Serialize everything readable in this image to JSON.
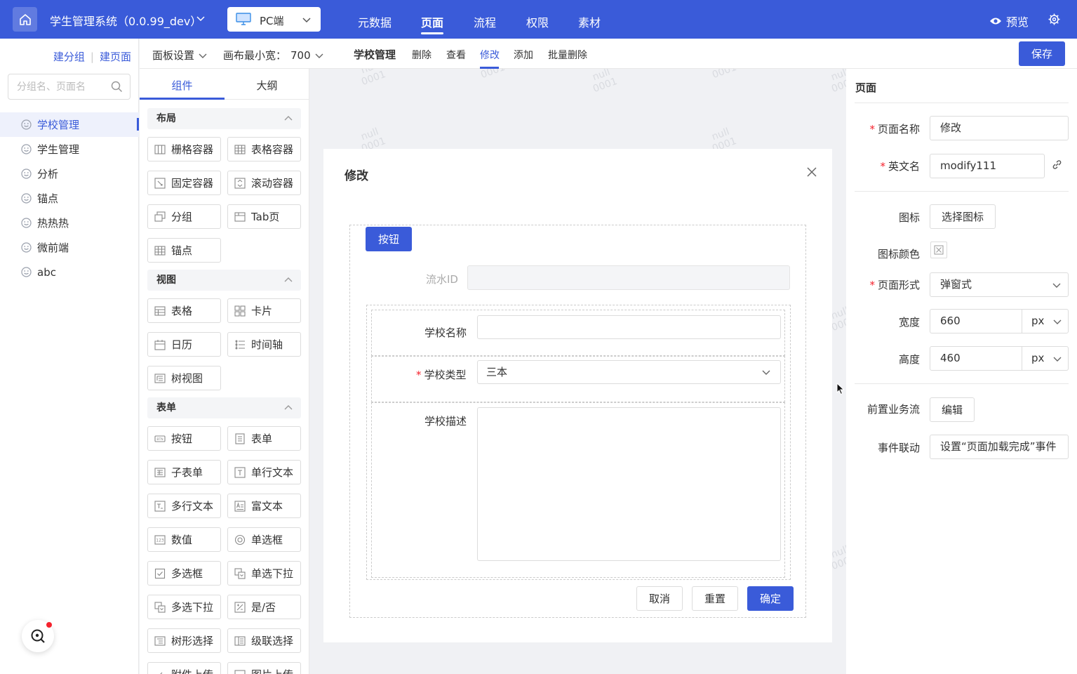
{
  "topbar": {
    "app_title": "学生管理系统（0.0.99_dev）",
    "platform": "PC端",
    "nav": [
      "元数据",
      "页面",
      "流程",
      "权限",
      "素材"
    ],
    "nav_active": "页面",
    "preview": "预览"
  },
  "sidebar": {
    "add_group": "建分组",
    "add_page": "建页面",
    "search_placeholder": "分组名、页面名",
    "items": [
      {
        "label": "学校管理",
        "active": true
      },
      {
        "label": "学生管理",
        "active": false
      },
      {
        "label": "分析",
        "active": false
      },
      {
        "label": "锚点",
        "active": false
      },
      {
        "label": "热热热",
        "active": false
      },
      {
        "label": "微前端",
        "active": false
      },
      {
        "label": "abc",
        "active": false
      }
    ]
  },
  "toolbar": {
    "panel_settings": "面板设置",
    "canvas_min_width_label": "画布最小宽：",
    "canvas_min_width_value": "700",
    "page_tabs": [
      "学校管理",
      "删除",
      "查看",
      "修改",
      "添加",
      "批量删除"
    ],
    "active_tab": "修改",
    "save": "保存"
  },
  "components": {
    "tabs": [
      "组件",
      "大纲"
    ],
    "active_tab": "组件",
    "groups": [
      {
        "title": "布局",
        "items": [
          "栅格容器",
          "表格容器",
          "固定容器",
          "滚动容器",
          "分组",
          "Tab页",
          "锚点"
        ]
      },
      {
        "title": "视图",
        "items": [
          "表格",
          "卡片",
          "日历",
          "时间轴",
          "树视图"
        ]
      },
      {
        "title": "表单",
        "items": [
          "按钮",
          "表单",
          "子表单",
          "单行文本",
          "多行文本",
          "富文本",
          "数值",
          "单选框",
          "多选框",
          "单选下拉",
          "多选下拉",
          "是/否",
          "树形选择",
          "级联选择",
          "附件上传",
          "图片上传"
        ]
      }
    ]
  },
  "canvas": {
    "watermark": [
      "null",
      "0001"
    ],
    "modal": {
      "title": "修改",
      "button_label": "按钮",
      "flow_id_label": "流水ID",
      "fields": [
        {
          "label": "学校名称",
          "required": false,
          "value": ""
        },
        {
          "label": "学校类型",
          "required": true,
          "value": "三本"
        },
        {
          "label": "学校描述",
          "required": false,
          "value": ""
        }
      ],
      "cancel": "取消",
      "reset": "重置",
      "confirm": "确定"
    }
  },
  "props": {
    "title": "页面",
    "page_name_label": "页面名称",
    "page_name_value": "修改",
    "english_name_label": "英文名",
    "english_name_value": "modify111",
    "icon_label": "图标",
    "icon_button": "选择图标",
    "icon_color_label": "图标颜色",
    "page_form_label": "页面形式",
    "page_form_value": "弹窗式",
    "width_label": "宽度",
    "width_value": "660",
    "width_unit": "px",
    "height_label": "高度",
    "height_value": "460",
    "height_unit": "px",
    "pre_flow_label": "前置业务流",
    "pre_flow_button": "编辑",
    "event_label": "事件联动",
    "event_value": "设置“页面加载完成”事件"
  },
  "colors": {
    "accent": "#3a5bd9",
    "required": "#f5222d",
    "watermark": "#d9dbe0"
  }
}
